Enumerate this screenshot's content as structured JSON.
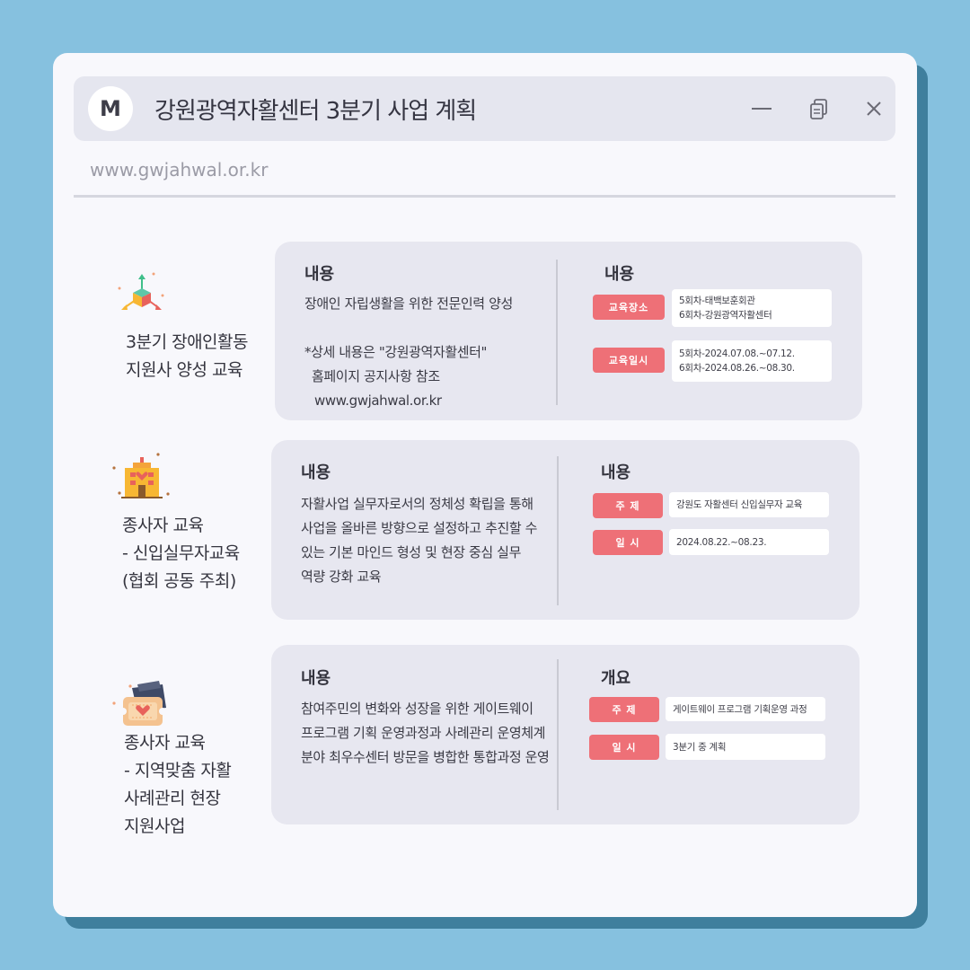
{
  "window": {
    "logo_letter": "M",
    "title": "강원광역자활센터 3분기 사업 계획",
    "url": "www.gwjahwal.or.kr"
  },
  "sections": [
    {
      "icon": "molecule-arrows-icon",
      "label_lines": [
        "3분기 장애인활동",
        "지원사 양성 교육"
      ],
      "left_heading": "내용",
      "desc_lines": [
        "장애인 자립생활을 위한 전문인력 양성",
        "",
        "*상세 내용은 \"강원광역자활센터\"",
        "  홈페이지 공지사항 참조",
        "   www.gwjahwal.or.kr"
      ],
      "right_heading": "내용",
      "rows": [
        {
          "tag": "교육장소",
          "value_lines": [
            "5회차-태백보훈회관",
            "6회차-강원광역자활센터"
          ]
        },
        {
          "tag": "교육일시",
          "value_lines": [
            "5회차-2024.07.08.~07.12.",
            "6회차-2024.08.26.~08.30."
          ]
        }
      ]
    },
    {
      "icon": "building-icon",
      "label_lines": [
        "종사자 교육",
        "- 신입실무자교육",
        "(협회 공동 주최)"
      ],
      "left_heading": "내용",
      "desc_lines": [
        "자활사업 실무자로서의 정체성 확립을 통해",
        "사업을 올바른 방향으로 설정하고 추진할 수",
        "있는 기본 마인드 형성 및 현장 중심 실무",
        "역량 강화 교육"
      ],
      "right_heading": "내용",
      "rows": [
        {
          "tag": "주 제",
          "value_lines": [
            "강원도 자활센터 신입실무자 교육"
          ]
        },
        {
          "tag": "일 시",
          "value_lines": [
            "2024.08.22.~08.23."
          ]
        }
      ]
    },
    {
      "icon": "heart-ticket-icon",
      "label_lines": [
        "종사자 교육",
        "- 지역맞춤 자활",
        "사례관리 현장",
        "지원사업"
      ],
      "left_heading": "내용",
      "desc_lines": [
        "참여주민의 변화와 성장을 위한 게이트웨이",
        "프로그램 기획 운영과정과 사례관리 운영체계",
        "분야 최우수센터 방문을 병합한 통합과정 운영"
      ],
      "right_heading": "개요",
      "rows": [
        {
          "tag": "주 제",
          "value_lines": [
            "게이트웨이 프로그램 기획운영 과정"
          ]
        },
        {
          "tag": "일 시",
          "value_lines": [
            "3분기 중 계획"
          ]
        }
      ]
    }
  ],
  "colors": {
    "background": "#86c1df",
    "window_shadow": "#3f7f9d",
    "window": "#f8f8fc",
    "card": "#e7e7f0",
    "tag": "#ee7077"
  }
}
